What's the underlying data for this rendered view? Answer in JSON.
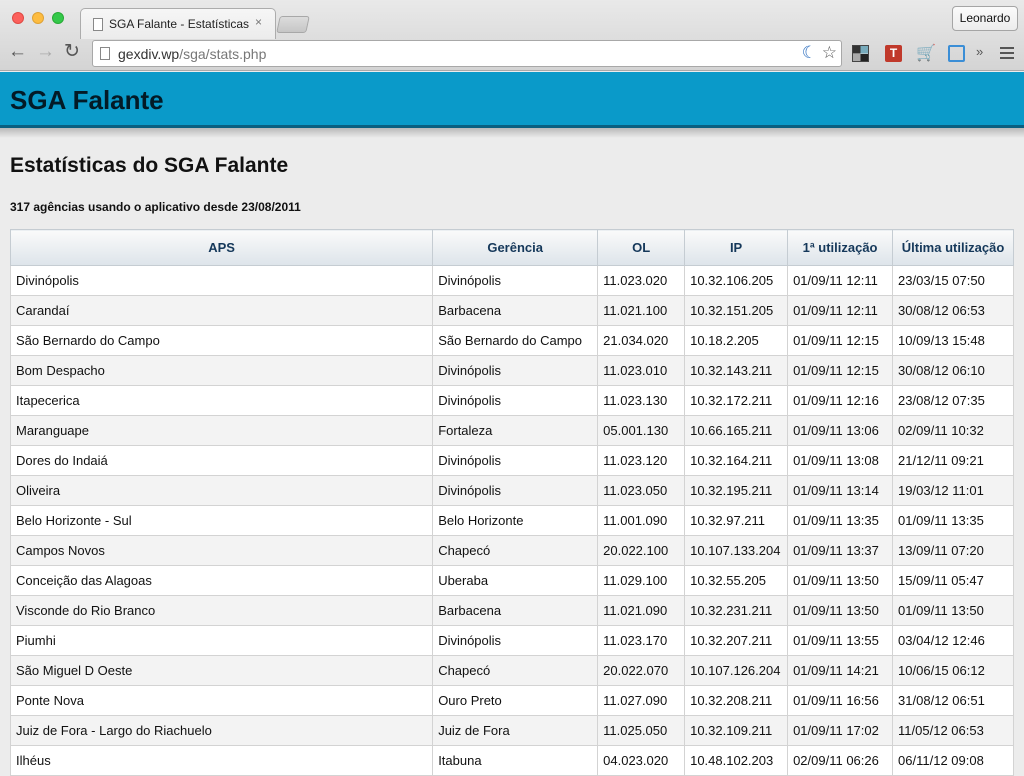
{
  "browser": {
    "tab_title": "SGA Falante - Estatísticas",
    "tab_close": "×",
    "profile_name": "Leonardo",
    "url_host": "gexdiv.wp",
    "url_path": "/sga/stats.php",
    "icons": [
      "back-icon",
      "forward-icon",
      "reload-icon",
      "moon-icon",
      "star-icon",
      "menu-icon"
    ],
    "ext_t_label": "T",
    "more_extensions": "»"
  },
  "header": {
    "title": "SGA Falante"
  },
  "page": {
    "heading": "Estatísticas do SGA Falante",
    "summary": "317 agências usando o aplicativo desde 23/08/2011"
  },
  "table": {
    "columns": [
      "APS",
      "Gerência",
      "OL",
      "IP",
      "1ª utilização",
      "Última utilização"
    ],
    "rows": [
      [
        "Divinópolis",
        "Divinópolis",
        "11.023.020",
        "10.32.106.205",
        "01/09/11 12:11",
        "23/03/15 07:50"
      ],
      [
        "Carandaí",
        "Barbacena",
        "11.021.100",
        "10.32.151.205",
        "01/09/11 12:11",
        "30/08/12 06:53"
      ],
      [
        "São Bernardo do Campo",
        "São Bernardo do Campo",
        "21.034.020",
        "10.18.2.205",
        "01/09/11 12:15",
        "10/09/13 15:48"
      ],
      [
        "Bom Despacho",
        "Divinópolis",
        "11.023.010",
        "10.32.143.211",
        "01/09/11 12:15",
        "30/08/12 06:10"
      ],
      [
        "Itapecerica",
        "Divinópolis",
        "11.023.130",
        "10.32.172.211",
        "01/09/11 12:16",
        "23/08/12 07:35"
      ],
      [
        "Maranguape",
        "Fortaleza",
        "05.001.130",
        "10.66.165.211",
        "01/09/11 13:06",
        "02/09/11 10:32"
      ],
      [
        "Dores do Indaiá",
        "Divinópolis",
        "11.023.120",
        "10.32.164.211",
        "01/09/11 13:08",
        "21/12/11 09:21"
      ],
      [
        "Oliveira",
        "Divinópolis",
        "11.023.050",
        "10.32.195.211",
        "01/09/11 13:14",
        "19/03/12 11:01"
      ],
      [
        "Belo Horizonte - Sul",
        "Belo Horizonte",
        "11.001.090",
        "10.32.97.211",
        "01/09/11 13:35",
        "01/09/11 13:35"
      ],
      [
        "Campos Novos",
        "Chapecó",
        "20.022.100",
        "10.107.133.204",
        "01/09/11 13:37",
        "13/09/11 07:20"
      ],
      [
        "Conceição das Alagoas",
        "Uberaba",
        "11.029.100",
        "10.32.55.205",
        "01/09/11 13:50",
        "15/09/11 05:47"
      ],
      [
        "Visconde do Rio Branco",
        "Barbacena",
        "11.021.090",
        "10.32.231.211",
        "01/09/11 13:50",
        "01/09/11 13:50"
      ],
      [
        "Piumhi",
        "Divinópolis",
        "11.023.170",
        "10.32.207.211",
        "01/09/11 13:55",
        "03/04/12 12:46"
      ],
      [
        "São Miguel D Oeste",
        "Chapecó",
        "20.022.070",
        "10.107.126.204",
        "01/09/11 14:21",
        "10/06/15 06:12"
      ],
      [
        "Ponte Nova",
        "Ouro Preto",
        "11.027.090",
        "10.32.208.211",
        "01/09/11 16:56",
        "31/08/12 06:51"
      ],
      [
        "Juiz de Fora - Largo do Riachuelo",
        "Juiz de Fora",
        "11.025.050",
        "10.32.109.211",
        "01/09/11 17:02",
        "11/05/12 06:53"
      ],
      [
        "Ilhéus",
        "Itabuna",
        "04.023.020",
        "10.48.102.203",
        "02/09/11 06:26",
        "06/11/12 09:08"
      ]
    ]
  }
}
